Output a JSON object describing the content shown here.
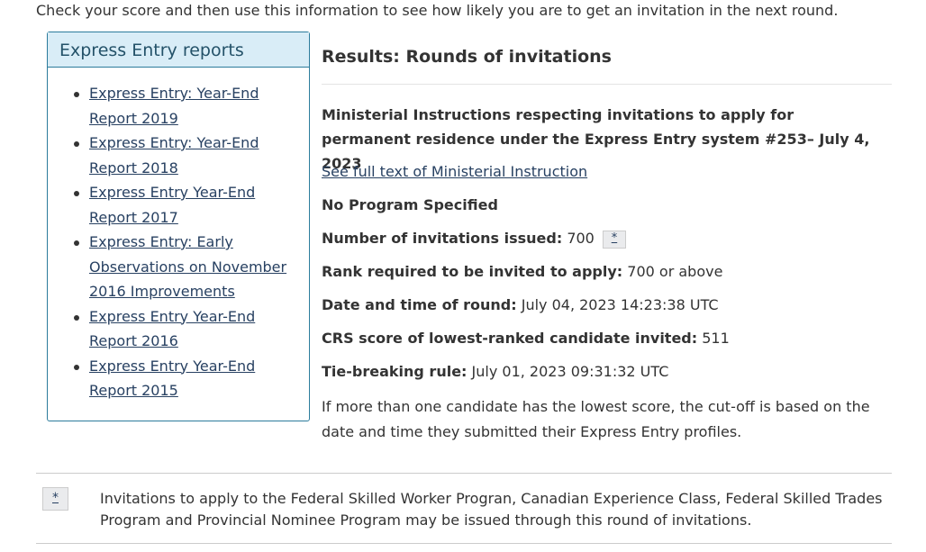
{
  "intro": "Check your score and then use this information to see how likely you are to get an invitation in the next round.",
  "panel": {
    "title": "Express Entry reports",
    "links": [
      "Express Entry: Year-End Report 2019",
      "Express Entry: Year-End Report 2018",
      "Express Entry Year-End Report 2017",
      "Express Entry: Early Observations on November 2016 Improvements",
      "Express Entry Year-End Report 2016",
      "Express Entry Year-End Report 2015"
    ]
  },
  "results": {
    "title": "Results: Rounds of invitations",
    "instruction": "Ministerial Instructions respecting invitations to apply for permanent residence under the Express Entry system #253– July 4, 2023",
    "full_text_link": "See full text of Ministerial Instruction",
    "program": "No Program Specified",
    "invitations_label": "Number of invitations issued:",
    "invitations_value": "700",
    "footnote_ref": "*",
    "rank_label": "Rank required to be invited to apply:",
    "rank_value": "700 or above",
    "date_label": "Date and time of round:",
    "date_value": "July 04, 2023 14:23:38 UTC",
    "crs_label": "CRS score of lowest-ranked candidate invited:",
    "crs_value": "511",
    "tie_label": "Tie-breaking rule:",
    "tie_value": "July 01, 2023 09:31:32 UTC",
    "note": "If more than one candidate has the lowest score, the cut-off is based on the date and time they submitted their Express Entry profiles."
  },
  "footnote": {
    "marker": "*",
    "text": "Invitations to apply to the Federal Skilled Worker Progran, Canadian Experience Class, Federal Skilled Trades Program and Provincial Nominee Program may be issued through this round of invitations."
  }
}
